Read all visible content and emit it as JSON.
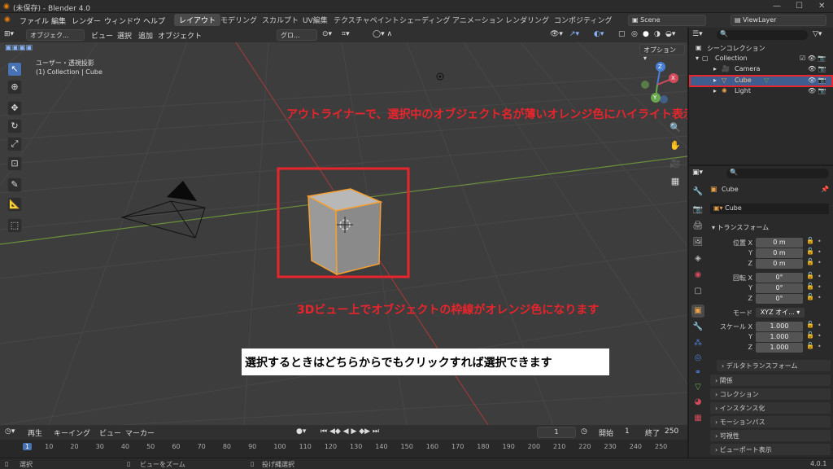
{
  "titlebar": {
    "title": "(未保存) - Blender 4.0"
  },
  "menu": {
    "items": [
      "ファイル",
      "編集",
      "レンダー",
      "ウィンドウ",
      "ヘルプ"
    ]
  },
  "workspaces": [
    "レイアウト",
    "モデリング",
    "スカルプト",
    "UV編集",
    "テクスチャペイント",
    "シェーディング",
    "アニメーション",
    "レンダリング",
    "コンポジティング"
  ],
  "scene": {
    "name": "Scene",
    "view_layer": "ViewLayer"
  },
  "viewport_header": {
    "mode": "オブジェク...",
    "menus": [
      "ビュー",
      "選択",
      "追加",
      "オブジェクト"
    ],
    "transform": "グロ...",
    "options": "オプション"
  },
  "viewport": {
    "view_name": "ユーザー・透視投影",
    "collection_info": "(1) Collection | Cube"
  },
  "annotations": {
    "outliner": "アウトライナーで、選択中のオブジェクト名が薄いオレンジ色にハイライト表示されます",
    "viewport": "3Dビュー上でオブジェクトの枠線がオレンジ色になります",
    "note": "選択するときはどちらからでもクリックすれば選択できます"
  },
  "gizmo": {
    "x": "X",
    "y": "Y",
    "z": "Z"
  },
  "outliner": {
    "scene_collection": "シーンコレクション",
    "collection": "Collection",
    "items": [
      {
        "name": "Camera"
      },
      {
        "name": "Cube",
        "selected": true
      },
      {
        "name": "Light"
      }
    ]
  },
  "properties": {
    "object_name": "Cube",
    "data_name": "Cube",
    "transform_title": "トランスフォーム",
    "location_label": "位置 X",
    "location": [
      "0 m",
      "0 m",
      "0 m"
    ],
    "rotation_label": "回転 X",
    "rotation": [
      "0°",
      "0°",
      "0°"
    ],
    "axis_y": "Y",
    "axis_z": "Z",
    "mode_label": "モード",
    "mode_value": "XYZ オイ...",
    "scale_label": "スケール X",
    "scale": [
      "1.000",
      "1.000",
      "1.000"
    ],
    "delta": "デルタトランスフォーム",
    "sections": [
      "関係",
      "コレクション",
      "インスタンス化",
      "モーションパス",
      "可視性",
      "ビューポート表示"
    ]
  },
  "timeline": {
    "menus": [
      "再生",
      "キーイング",
      "ビュー",
      "マーカー"
    ],
    "current_frame": "1",
    "start_label": "開始",
    "start": "1",
    "end_label": "終了",
    "end": "250",
    "frames": [
      "1",
      "10",
      "20",
      "30",
      "40",
      "50",
      "60",
      "70",
      "80",
      "90",
      "100",
      "110",
      "120",
      "130",
      "140",
      "150",
      "160",
      "170",
      "180",
      "190",
      "200",
      "210",
      "220",
      "230",
      "240",
      "250"
    ]
  },
  "statusbar": {
    "select": "選択",
    "zoom": "ビューをズーム",
    "lasso": "投げ縄選択",
    "version": "4.0.1"
  },
  "colors": {
    "accent": "#4772b3",
    "select_outline": "#f5a030",
    "annotation": "#e8242c"
  }
}
